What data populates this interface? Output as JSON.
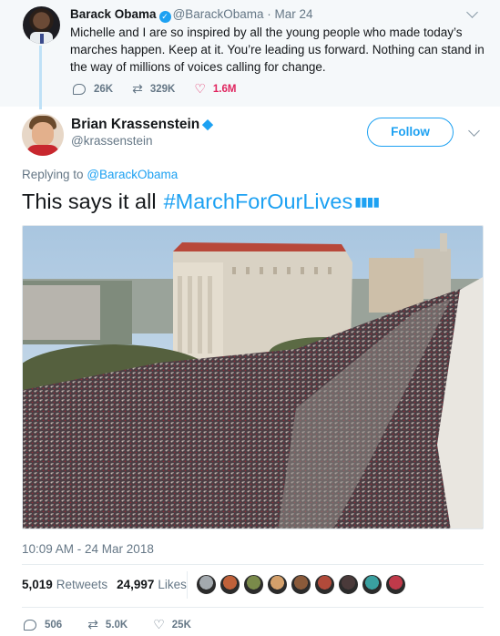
{
  "parent_tweet": {
    "author_name": "Barack Obama",
    "verified_icon": "verified-badge-icon",
    "meta": "@BarackObama · Mar 24",
    "text": "Michelle and I are so inspired by all the young people who made today’s marches happen. Keep at it. You’re leading us forward. Nothing can stand in the way of millions of voices calling for change.",
    "replies": "26K",
    "retweets": "329K",
    "likes": "1.6M"
  },
  "tweet": {
    "author_name": "Brian Krassenstein",
    "handle": "@krassenstein",
    "follow_label": "Follow",
    "replying_prefix": "Replying to",
    "replying_to": "@BarackObama",
    "text": "This says it all",
    "hashtag": "#MarchForOurLives",
    "timestamp": "10:09 AM - 24 Mar 2018",
    "retweet_count": "5,019",
    "retweet_label": "Retweets",
    "like_count": "24,997",
    "like_label": "Likes",
    "replies": "506",
    "retweets": "5.0K",
    "likes": "25K"
  },
  "colors": {
    "accent": "#1da1f2",
    "like_red": "#e0245e",
    "muted": "#657786",
    "liker_avatars": [
      "#a3a9ae",
      "#c0613a",
      "#7a8a4a",
      "#d4a06b",
      "#8a5a3a",
      "#b14a3a",
      "#4a3a3a",
      "#3aa0a0",
      "#c03a4a"
    ]
  }
}
